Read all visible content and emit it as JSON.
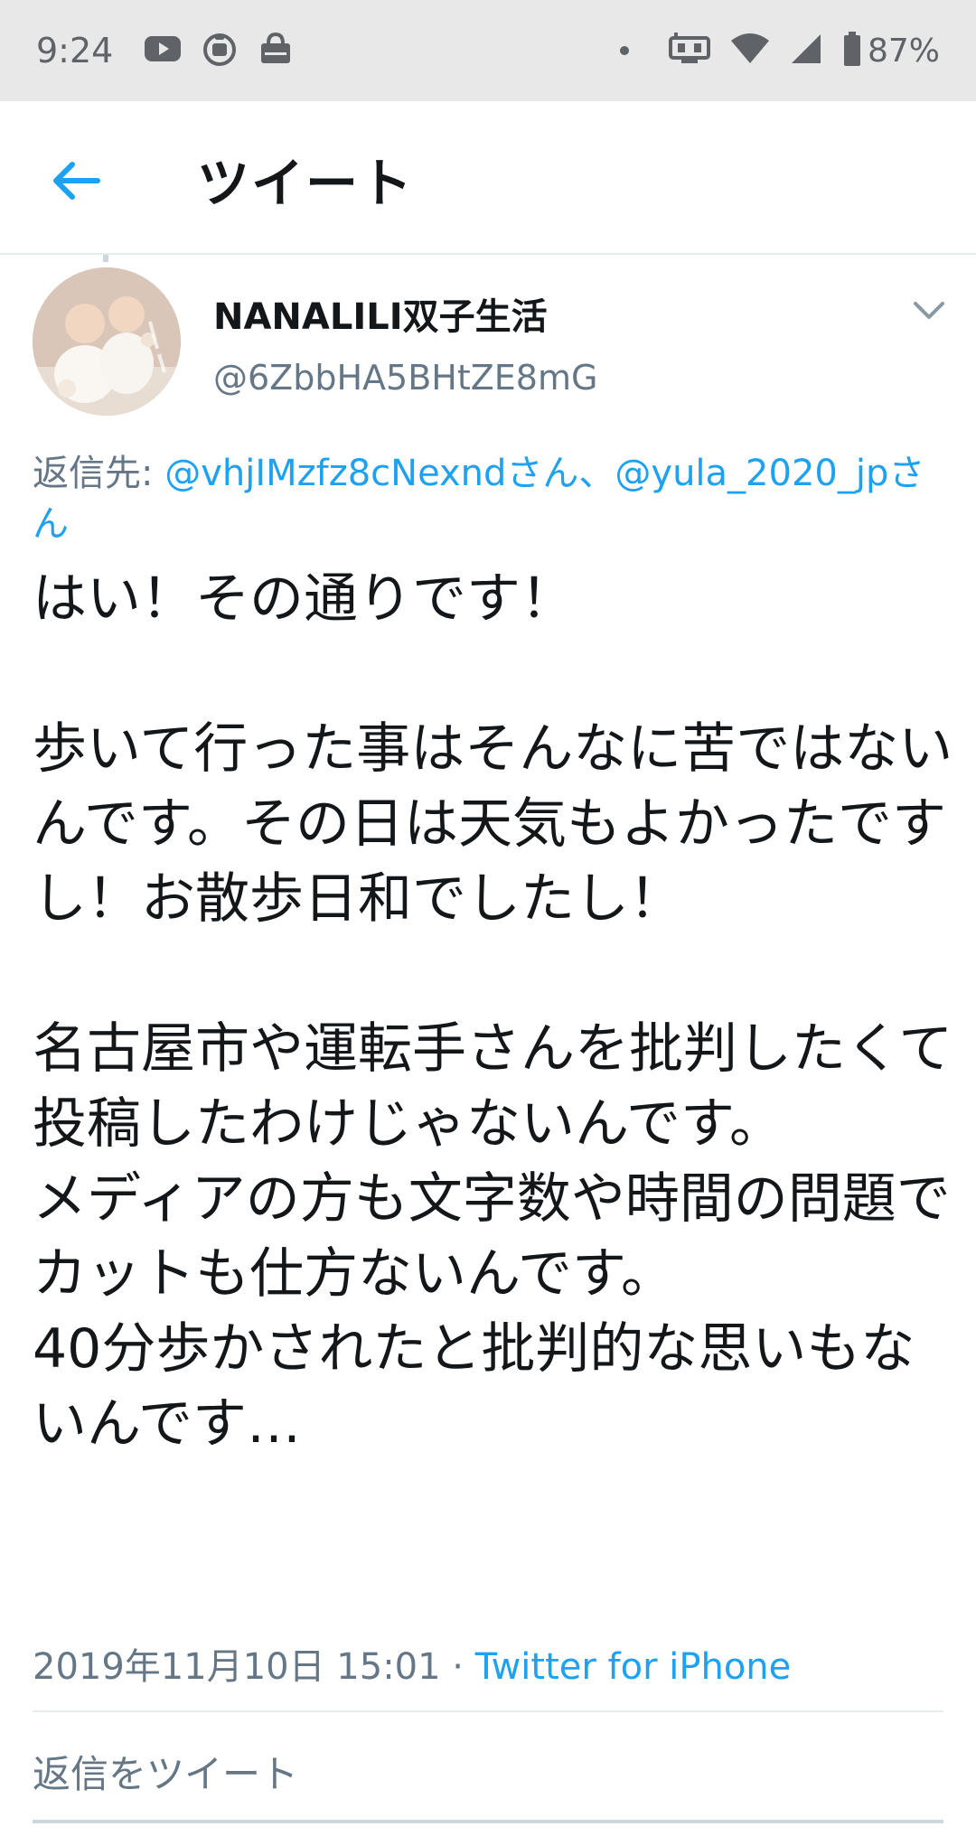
{
  "status_bar": {
    "time": "9:24",
    "battery": "87%",
    "icons": [
      "youtube-icon",
      "app-icon",
      "market-icon",
      "dot-icon",
      "cast-icon",
      "wifi-icon",
      "signal-icon",
      "battery-icon"
    ]
  },
  "header": {
    "title": "ツイート"
  },
  "tweet": {
    "display_name": "NANALILI双子生活",
    "handle": "@6ZbbHA5BHtZE8mG",
    "reply_prefix": "返信先: ",
    "reply_mention_1": "@vhjIMzfz8cNexndさん、",
    "reply_mention_2": "@yula_2020_jpさん",
    "text": "はい！その通りです！\n\n歩いて行った事はそんなに苦ではないんです。その日は天気もよかったですし！お散歩日和でしたし！\n\n名古屋市や運転手さんを批判したくて投稿したわけじゃないんです。\nメディアの方も文字数や時間の問題でカットも仕方ないんです。\n40分歩かされたと批判的な思いもないんです…",
    "date": "2019年11月10日 15:01",
    "separator": " · ",
    "source": "Twitter for iPhone"
  },
  "reply_box": {
    "placeholder": "返信をツイート"
  },
  "colors": {
    "accent": "#1da1f2",
    "secondary_text": "#657786",
    "status_bar_bg": "#e8e8e8"
  }
}
